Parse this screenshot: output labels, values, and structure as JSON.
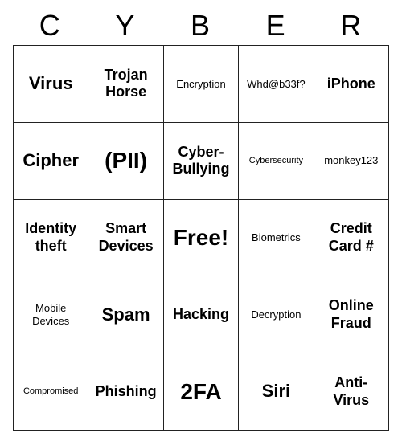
{
  "header": {
    "letters": [
      "C",
      "Y",
      "B",
      "E",
      "R"
    ]
  },
  "grid": [
    [
      {
        "text": "Virus",
        "size": "large"
      },
      {
        "text": "Trojan Horse",
        "size": "medium"
      },
      {
        "text": "Encryption",
        "size": "small"
      },
      {
        "text": "Whd@b33f?",
        "size": "small"
      },
      {
        "text": "iPhone",
        "size": "medium"
      }
    ],
    [
      {
        "text": "Cipher",
        "size": "large"
      },
      {
        "text": "(PII)",
        "size": "xlarge"
      },
      {
        "text": "Cyber-Bullying",
        "size": "medium"
      },
      {
        "text": "Cybersecurity",
        "size": "xsmall"
      },
      {
        "text": "monkey123",
        "size": "small"
      }
    ],
    [
      {
        "text": "Identity theft",
        "size": "medium"
      },
      {
        "text": "Smart Devices",
        "size": "medium"
      },
      {
        "text": "Free!",
        "size": "xlarge"
      },
      {
        "text": "Biometrics",
        "size": "small"
      },
      {
        "text": "Credit Card #",
        "size": "medium"
      }
    ],
    [
      {
        "text": "Mobile Devices",
        "size": "small"
      },
      {
        "text": "Spam",
        "size": "large"
      },
      {
        "text": "Hacking",
        "size": "medium"
      },
      {
        "text": "Decryption",
        "size": "small"
      },
      {
        "text": "Online Fraud",
        "size": "medium"
      }
    ],
    [
      {
        "text": "Compromised",
        "size": "xsmall"
      },
      {
        "text": "Phishing",
        "size": "medium"
      },
      {
        "text": "2FA",
        "size": "xlarge"
      },
      {
        "text": "Siri",
        "size": "large"
      },
      {
        "text": "Anti-Virus",
        "size": "medium"
      }
    ]
  ]
}
